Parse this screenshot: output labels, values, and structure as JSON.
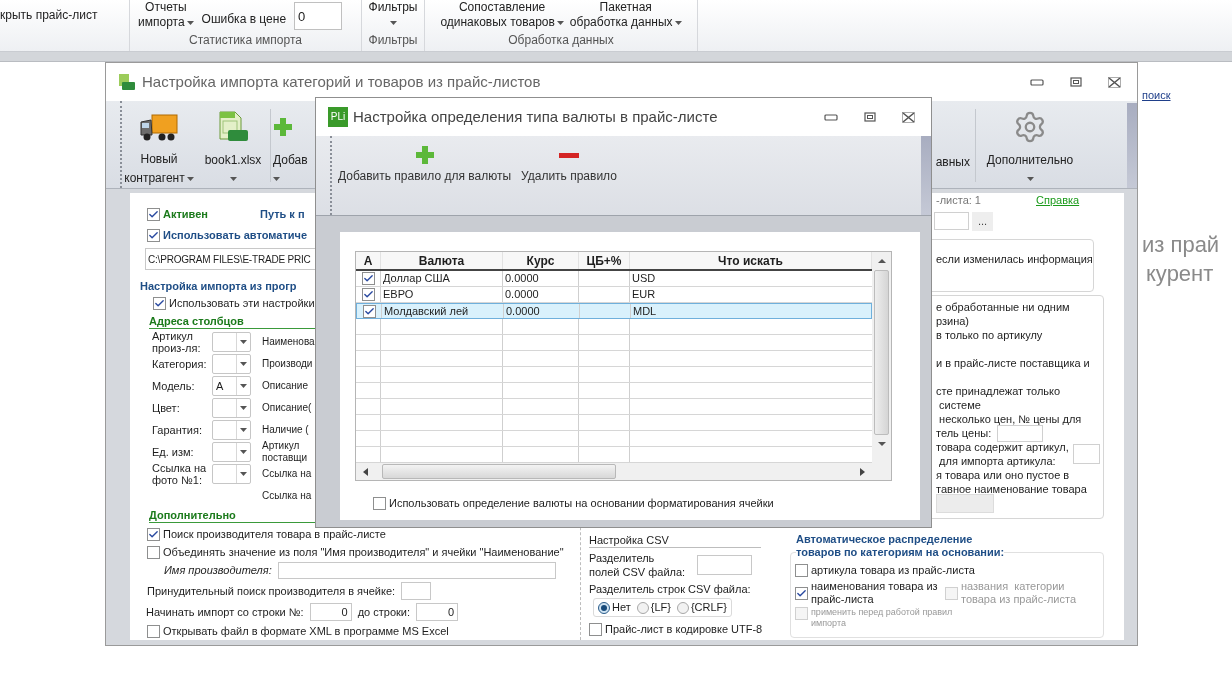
{
  "ribbon": {
    "cut_button": "крыть прайс-лист",
    "stats_group": {
      "label": "Статистика импорта",
      "reports_button": [
        "Отчеты",
        "импорта"
      ],
      "price_error_label": "Ошибка в цене",
      "price_error_value": "0"
    },
    "filters_group": {
      "label": "Фильтры",
      "button": "Фильтры"
    },
    "processing_group": {
      "label": "Обработка данных",
      "buttons": [
        [
          "Сопоставление",
          "одинаковых товаров"
        ],
        [
          "Пакетная",
          "обработка данных"
        ]
      ]
    }
  },
  "background": {
    "search_link": "поиск",
    "text_lines": [
      "из прай",
      "курент"
    ]
  },
  "main_window": {
    "title": "Настройка импорта категорий и товаров из прайс-листов",
    "toolbar_left": [
      {
        "lines": [
          "Новый",
          "контрагент"
        ],
        "dropdown": true
      },
      {
        "lines": [
          "book1.xlsx"
        ],
        "dropdown": true
      },
      {
        "lines": [
          "Добав"
        ],
        "dropdown": true
      }
    ],
    "toolbar_right": [
      {
        "lines": [
          "авных"
        ],
        "dropdown": false
      },
      {
        "lines": [
          "Дополнительно"
        ],
        "dropdown": true
      }
    ],
    "left": {
      "active": {
        "label": "Активен",
        "checked": true
      },
      "path_label": "Путь к п",
      "auto_path": {
        "label": "Использовать автоматиче",
        "checked": true
      },
      "path_value": "C:\\PROGRAM FILES\\E-TRADE PRIC",
      "program_title": "Настройка импорта из прогр",
      "use_settings": {
        "label": "Использовать эти настройки",
        "checked": true
      },
      "columns_title": "Адреса столбцов",
      "column_rows": [
        {
          "label": [
            "Артикул",
            "произ-ля:"
          ],
          "combo": true,
          "right": [
            "Наименова"
          ]
        },
        {
          "label": [
            "Категория:"
          ],
          "combo": true,
          "right": [
            "Производи"
          ]
        },
        {
          "label": [
            "Модель:"
          ],
          "combo": true,
          "value": "A",
          "right": [
            "Описание"
          ]
        },
        {
          "label": [
            "Цвет:"
          ],
          "combo": true,
          "right": [
            "Описание("
          ]
        },
        {
          "label": [
            "Гарантия:"
          ],
          "combo": true,
          "right": [
            "Наличие ("
          ]
        },
        {
          "label": [
            "Ед. изм:"
          ],
          "combo": true,
          "right": [
            "Артикул",
            "поставщи"
          ]
        },
        {
          "label": [
            "Ссылка на",
            "фото №1:"
          ],
          "combo": true,
          "right": [
            "Ссылка на"
          ]
        },
        {
          "combo": false,
          "right": [
            "Ссылка на"
          ]
        }
      ],
      "extra_title": "Дополнительно",
      "find_manufacturer": {
        "label": "Поиск производителя товара в прайс-листе",
        "checked": true
      },
      "merge_name": {
        "label": "Объединять значение из поля \"Имя производителя\" и ячейки \"Наименование\"",
        "checked": false
      },
      "manufacturer_name_label": "Имя производителя:",
      "forced_search_label": "Принудительный поиск производителя в ячейке:",
      "start_row_label": "Начинать импорт со строки №:",
      "start_row": "0",
      "end_row_label": "до строки:",
      "end_row": "0",
      "open_xml": {
        "label": "Открывать файл в формате XML в программе MS Excel",
        "checked": false
      }
    },
    "csv": {
      "title": "Настройка CSV",
      "field_sep_label": [
        "Разделитель",
        "полей CSV файла:"
      ],
      "row_sep_label": "Разделитель строк CSV файла:",
      "row_seps": [
        {
          "label": "Нет",
          "selected": true
        },
        {
          "label": "{LF}",
          "selected": false
        },
        {
          "label": "{CRLF}",
          "selected": false
        }
      ],
      "utf8": {
        "label": "Прайс-лист в кодировке UTF-8",
        "checked": false
      }
    },
    "right": {
      "count_label": "-листа: 1",
      "help_link": "Справка",
      "browse_button": "...",
      "update_text": "если изменилась информация",
      "paragraphs": [
        {
          "lines": [
            "е обработанные ни одним",
            "рзина)"
          ],
          "kind": "text"
        },
        {
          "lines": [
            "в только по артикулу"
          ],
          "kind": "text"
        },
        {
          "lines": [
            "и в прайс-листе поставщика и"
          ],
          "kind": "text"
        },
        {
          "lines": [
            "сте принадлежат только",
            " системе"
          ],
          "kind": "text"
        },
        {
          "lines": [
            " несколько цен, № цены для",
            "тель цены:"
          ],
          "kind": "inline_field"
        },
        {
          "lines": [
            "товара содержит артикул,",
            " для импорта артикула:"
          ],
          "kind": "side_field"
        },
        {
          "lines": [
            "я товара или оно пустое в",
            "тавное наименование товара"
          ],
          "kind": "text"
        }
      ],
      "auto_title": [
        "Автоматическое распределение",
        "товаров по категориям на основании:"
      ],
      "auto_options": [
        {
          "label": "артикула товара из прайс-листа",
          "checked": false,
          "disabled": false,
          "kind": "wide"
        },
        {
          "label": "наименования товара из прайс-листа",
          "checked": true,
          "disabled": false,
          "kind": "left"
        },
        {
          "label": "названия  категории товара из прайс-листа",
          "checked": false,
          "disabled": true,
          "kind": "right"
        },
        {
          "label": "применить перед работой правил импорта",
          "checked": false,
          "disabled": true,
          "kind": "note"
        }
      ]
    }
  },
  "currency_dialog": {
    "logo": "PLi",
    "title": "Настройка определения типа валюты в прайс-листе",
    "toolbar": [
      {
        "label": "Добавить правило для валюты"
      },
      {
        "label": "Удалить правило"
      }
    ],
    "table": {
      "columns": [
        "А",
        "Валюта",
        "Курс",
        "ЦБ+%",
        "Что искать"
      ],
      "rows": [
        {
          "active": true,
          "currency": "Доллар США",
          "rate": "0.0000",
          "search": "USD",
          "selected": false
        },
        {
          "active": true,
          "currency": "ЕВРО",
          "rate": "0.0000",
          "search": "EUR",
          "selected": false
        },
        {
          "active": true,
          "currency": "Молдавский лей",
          "rate": "0.0000",
          "search": "MDL",
          "selected": true
        }
      ]
    },
    "use_formatting": {
      "label": "Использовать определение валюты на основании форматирования ячейки",
      "checked": false
    }
  }
}
